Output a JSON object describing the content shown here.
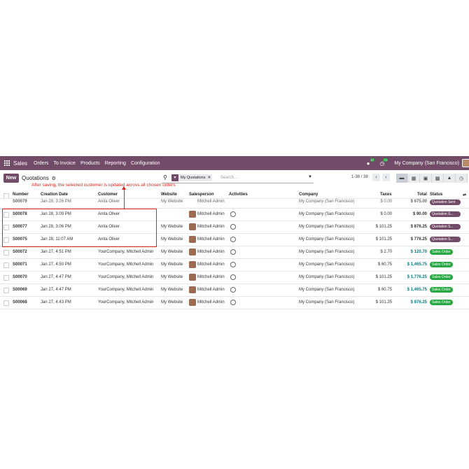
{
  "navbar": {
    "app_name": "Sales",
    "menu": [
      "Orders",
      "To Invoice",
      "Products",
      "Reporting",
      "Configuration"
    ],
    "messages_count": "17",
    "activities_count": "73",
    "company": "My Company (San Francisco)"
  },
  "control_panel": {
    "new_label": "New",
    "title": "Quotations",
    "facet": "My Quotations",
    "search_placeholder": "Search...",
    "pager": "1-38 / 38"
  },
  "annotation": "After saving, the selected customer is updated across all chosen orders",
  "columns": [
    "Number",
    "Creation Date",
    "Customer",
    "Website",
    "Salesperson",
    "Activities",
    "Company",
    "Taxes",
    "Total",
    "Status"
  ],
  "partial_row": {
    "number": "S00079",
    "date": "Jan 28, 3:26 PM",
    "customer": "Anita Oliver",
    "website": "My Website",
    "salesperson": "Mitchell Admin",
    "company": "My Company (San Francisco)",
    "taxes": "$ 0.00",
    "total": "$ 675.00",
    "status": "Quotation Sent"
  },
  "rows": [
    {
      "number": "S00078",
      "date": "Jan 28, 3:09 PM",
      "customer": "Anita Oliver",
      "website": "",
      "salesperson": "Mitchell Admin",
      "company": "My Company (San Francisco)",
      "taxes": "$ 0.00",
      "total": "$ 90.00",
      "status": "Quotation S..."
    },
    {
      "number": "S00077",
      "date": "Jan 28, 3:06 PM",
      "customer": "Anita Oliver",
      "website": "My Website",
      "salesperson": "Mitchell Admin",
      "company": "My Company (San Francisco)",
      "taxes": "$ 101.25",
      "total": "$ 876.25",
      "status": "Quotation S..."
    },
    {
      "number": "S00075",
      "date": "Jan 28, 11:07 AM",
      "customer": "Anita Oliver",
      "website": "My Website",
      "salesperson": "Mitchell Admin",
      "company": "My Company (San Francisco)",
      "taxes": "$ 101.25",
      "total": "$ 776.25",
      "status": "Quotation S..."
    },
    {
      "number": "S00072",
      "date": "Jan 27, 4:51 PM",
      "customer": "YourCompany, Mitchell Admin",
      "website": "My Website",
      "salesperson": "Mitchell Admin",
      "company": "My Company (San Francisco)",
      "taxes": "$ 2.70",
      "total": "$ 120.70",
      "status": "Sales Order"
    },
    {
      "number": "S00071",
      "date": "Jan 27, 4:50 PM",
      "customer": "YourCompany, Mitchell Admin",
      "website": "My Website",
      "salesperson": "Mitchell Admin",
      "company": "My Company (San Francisco)",
      "taxes": "$ 60.75",
      "total": "$ 1,465.75",
      "status": "Sales Order"
    },
    {
      "number": "S00070",
      "date": "Jan 27, 4:47 PM",
      "customer": "YourCompany, Mitchell Admin",
      "website": "My Website",
      "salesperson": "Mitchell Admin",
      "company": "My Company (San Francisco)",
      "taxes": "$ 101.25",
      "total": "$ 1,776.25",
      "status": "Sales Order"
    },
    {
      "number": "S00069",
      "date": "Jan 27, 4:47 PM",
      "customer": "YourCompany, Mitchell Admin",
      "website": "My Website",
      "salesperson": "Mitchell Admin",
      "company": "My Company (San Francisco)",
      "taxes": "$ 60.75",
      "total": "$ 1,465.75",
      "status": "Sales Order"
    },
    {
      "number": "S00068",
      "date": "Jan 27, 4:43 PM",
      "customer": "YourCompany, Mitchell Admin",
      "website": "My Website",
      "salesperson": "Mitchell Admin",
      "company": "My Company (San Francisco)",
      "taxes": "$ 101.25",
      "total": "$ 876.25",
      "status": "Sales Order"
    }
  ]
}
